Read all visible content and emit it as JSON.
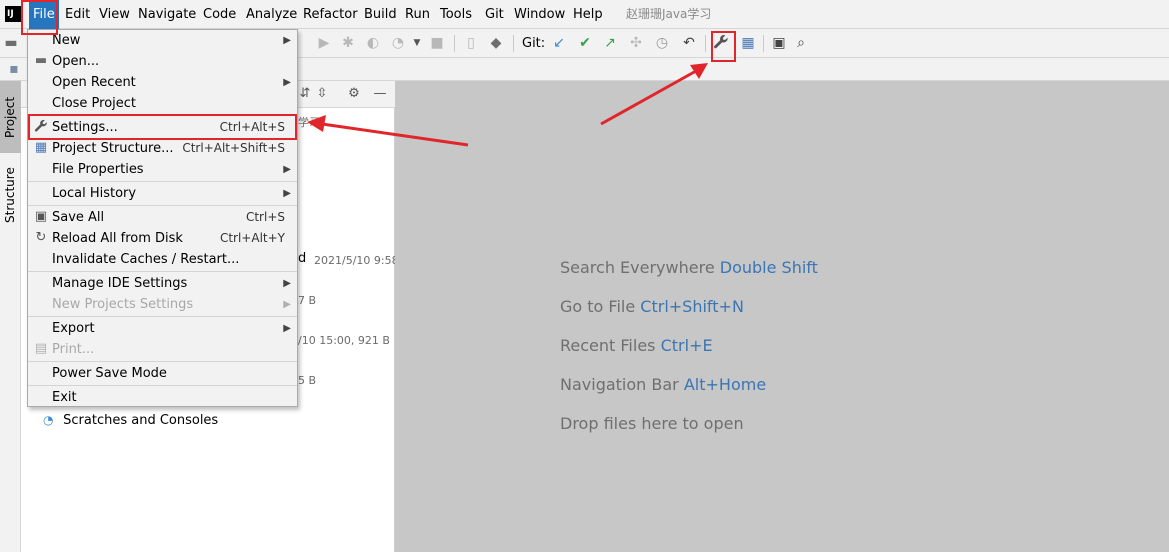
{
  "menubar": {
    "logo": "IJ",
    "items": [
      "File",
      "Edit",
      "View",
      "Navigate",
      "Code",
      "Analyze",
      "Refactor",
      "Build",
      "Run",
      "Tools",
      "Git",
      "Window",
      "Help"
    ],
    "title": "赵珊珊Java学习"
  },
  "toolbar": {
    "git_label": "Git:"
  },
  "left_strip": {
    "project_tab": "Project",
    "structure_tab": "Structure"
  },
  "project_panel": {
    "partial_ime": "学习",
    "row_d": "d",
    "row_date": "2021/5/10 9:58,",
    "row_7b": "7 B",
    "row_921": "/10 15:00, 921 B",
    "row_5b": "5 B",
    "scratches": "Scratches and Consoles"
  },
  "file_menu": {
    "items": [
      {
        "label": "New",
        "shortcut": "",
        "submenu": true,
        "disabled": false,
        "icon": ""
      },
      {
        "label": "Open...",
        "shortcut": "",
        "submenu": false,
        "disabled": false,
        "icon": "folder-icon"
      },
      {
        "label": "Open Recent",
        "shortcut": "",
        "submenu": true,
        "disabled": false,
        "icon": ""
      },
      {
        "label": "Close Project",
        "shortcut": "",
        "submenu": false,
        "disabled": false,
        "icon": ""
      },
      {
        "label": "Settings...",
        "shortcut": "Ctrl+Alt+S",
        "submenu": false,
        "disabled": false,
        "icon": "wrench-icon"
      },
      {
        "label": "Project Structure...",
        "shortcut": "Ctrl+Alt+Shift+S",
        "submenu": false,
        "disabled": false,
        "icon": "project-structure-icon"
      },
      {
        "label": "File Properties",
        "shortcut": "",
        "submenu": true,
        "disabled": false,
        "icon": ""
      },
      {
        "label": "Local History",
        "shortcut": "",
        "submenu": true,
        "disabled": false,
        "icon": ""
      },
      {
        "label": "Save All",
        "shortcut": "Ctrl+S",
        "submenu": false,
        "disabled": false,
        "icon": "save-icon"
      },
      {
        "label": "Reload All from Disk",
        "shortcut": "Ctrl+Alt+Y",
        "submenu": false,
        "disabled": false,
        "icon": "reload-icon"
      },
      {
        "label": "Invalidate Caches / Restart...",
        "shortcut": "",
        "submenu": false,
        "disabled": false,
        "icon": ""
      },
      {
        "label": "Manage IDE Settings",
        "shortcut": "",
        "submenu": true,
        "disabled": false,
        "icon": ""
      },
      {
        "label": "New Projects Settings",
        "shortcut": "",
        "submenu": true,
        "disabled": true,
        "icon": ""
      },
      {
        "label": "Export",
        "shortcut": "",
        "submenu": true,
        "disabled": false,
        "icon": ""
      },
      {
        "label": "Print...",
        "shortcut": "",
        "submenu": false,
        "disabled": true,
        "icon": "print-icon"
      },
      {
        "label": "Power Save Mode",
        "shortcut": "",
        "submenu": false,
        "disabled": false,
        "icon": ""
      },
      {
        "label": "Exit",
        "shortcut": "",
        "submenu": false,
        "disabled": false,
        "icon": ""
      }
    ]
  },
  "editor_hints": [
    {
      "text": "Search Everywhere",
      "shortcut": "Double Shift"
    },
    {
      "text": "Go to File",
      "shortcut": "Ctrl+Shift+N"
    },
    {
      "text": "Recent Files",
      "shortcut": "Ctrl+E"
    },
    {
      "text": "Navigation Bar",
      "shortcut": "Alt+Home"
    },
    {
      "text": "Drop files here to open",
      "shortcut": ""
    }
  ],
  "colors": {
    "menu_active": "#2675bf",
    "shortcut_blue": "#3b75b3",
    "annotation_red": "#e0262b",
    "editor_bg": "#c7c7c7"
  }
}
